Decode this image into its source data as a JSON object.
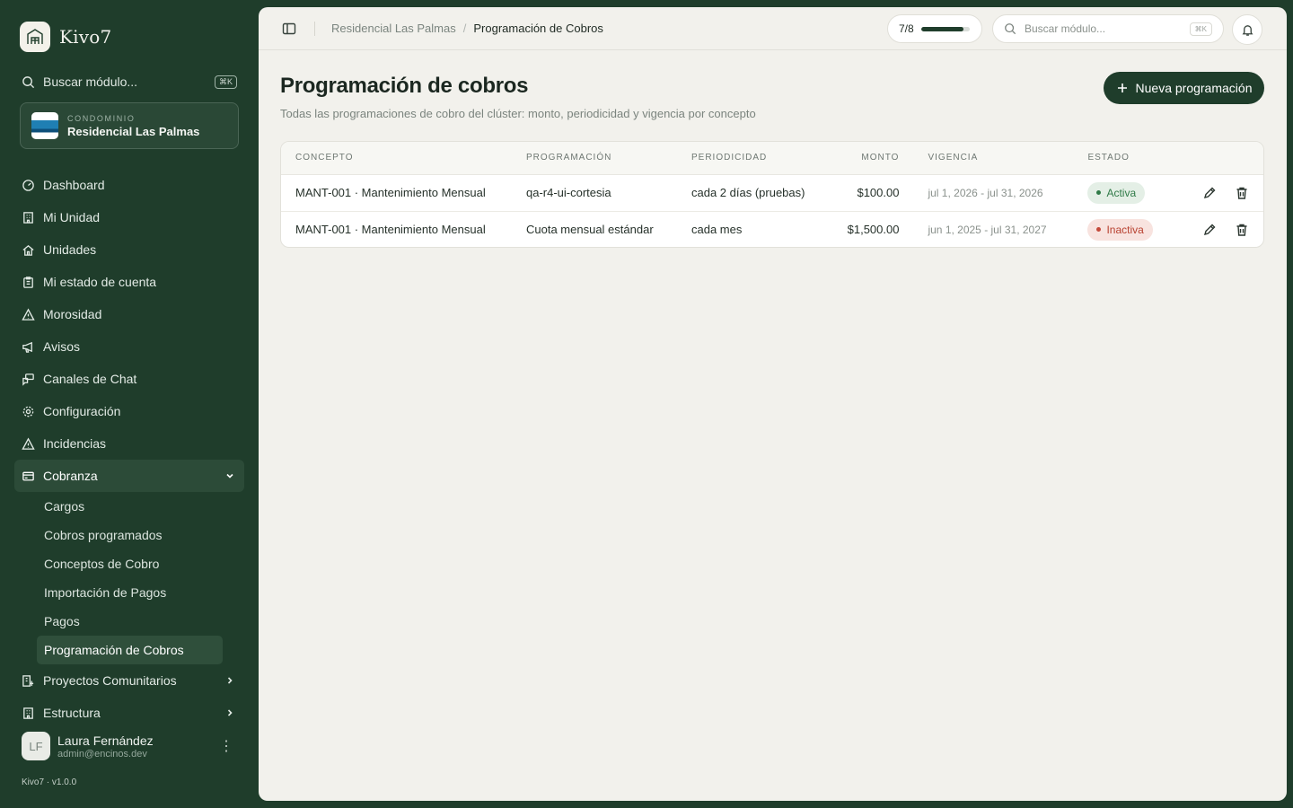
{
  "brand": {
    "name": "Kivo7"
  },
  "sidebar": {
    "search_label": "Buscar módulo...",
    "search_kbd": "⌘K",
    "condo": {
      "kicker": "CONDOMINIO",
      "name": "Residencial Las Palmas"
    },
    "items": [
      {
        "label": "Dashboard",
        "icon": "gauge-icon"
      },
      {
        "label": "Mi Unidad",
        "icon": "building-icon"
      },
      {
        "label": "Unidades",
        "icon": "home-icon"
      },
      {
        "label": "Mi estado de cuenta",
        "icon": "clipboard-icon"
      },
      {
        "label": "Morosidad",
        "icon": "warning-icon"
      },
      {
        "label": "Avisos",
        "icon": "megaphone-icon"
      },
      {
        "label": "Canales de Chat",
        "icon": "chat-icon"
      },
      {
        "label": "Configuración",
        "icon": "gear-icon"
      },
      {
        "label": "Incidencias",
        "icon": "warning-icon"
      },
      {
        "label": "Cobranza",
        "icon": "card-icon"
      }
    ],
    "cobranza_sub": [
      {
        "label": "Cargos"
      },
      {
        "label": "Cobros programados"
      },
      {
        "label": "Conceptos de Cobro"
      },
      {
        "label": "Importación de Pagos"
      },
      {
        "label": "Pagos"
      },
      {
        "label": "Programación de Cobros"
      }
    ],
    "items_after": [
      {
        "label": "Proyectos Comunitarios",
        "icon": "building-plus-icon"
      },
      {
        "label": "Estructura",
        "icon": "building-icon"
      }
    ],
    "user": {
      "initials": "LF",
      "name": "Laura Fernández",
      "email": "admin@encinos.dev"
    },
    "version": "Kivo7 · v1.0.0"
  },
  "topbar": {
    "breadcrumb": {
      "parent": "Residencial Las Palmas",
      "sep": "/",
      "current": "Programación de Cobros"
    },
    "progress": {
      "label": "7/8",
      "fraction": 0.875
    },
    "search_placeholder": "Buscar módulo...",
    "search_kbd": "⌘K"
  },
  "page": {
    "title": "Programación de cobros",
    "subtitle": "Todas las programaciones de cobro del clúster: monto, periodicidad y vigencia por concepto",
    "new_button": "Nueva programación"
  },
  "table": {
    "headers": [
      "CONCEPTO",
      "PROGRAMACIÓN",
      "PERIODICIDAD",
      "MONTO",
      "VIGENCIA",
      "ESTADO"
    ],
    "rows": [
      {
        "concepto": "MANT-001 · Mantenimiento Mensual",
        "programacion": "qa-r4-ui-cortesia",
        "periodicidad": "cada 2 días (pruebas)",
        "monto": "$100.00",
        "vigencia": "jul 1, 2026 - jul 31, 2026",
        "estado": "Activa"
      },
      {
        "concepto": "MANT-001 · Mantenimiento Mensual",
        "programacion": "Cuota mensual estándar",
        "periodicidad": "cada mes",
        "monto": "$1,500.00",
        "vigencia": "jun 1, 2025 - jul 31, 2027",
        "estado": "Inactiva"
      }
    ]
  },
  "colors": {
    "sidebar_bg": "#1f3d2b",
    "accent": "#1f3d2b",
    "active": "#2f7a47",
    "inactive": "#b8402f"
  }
}
